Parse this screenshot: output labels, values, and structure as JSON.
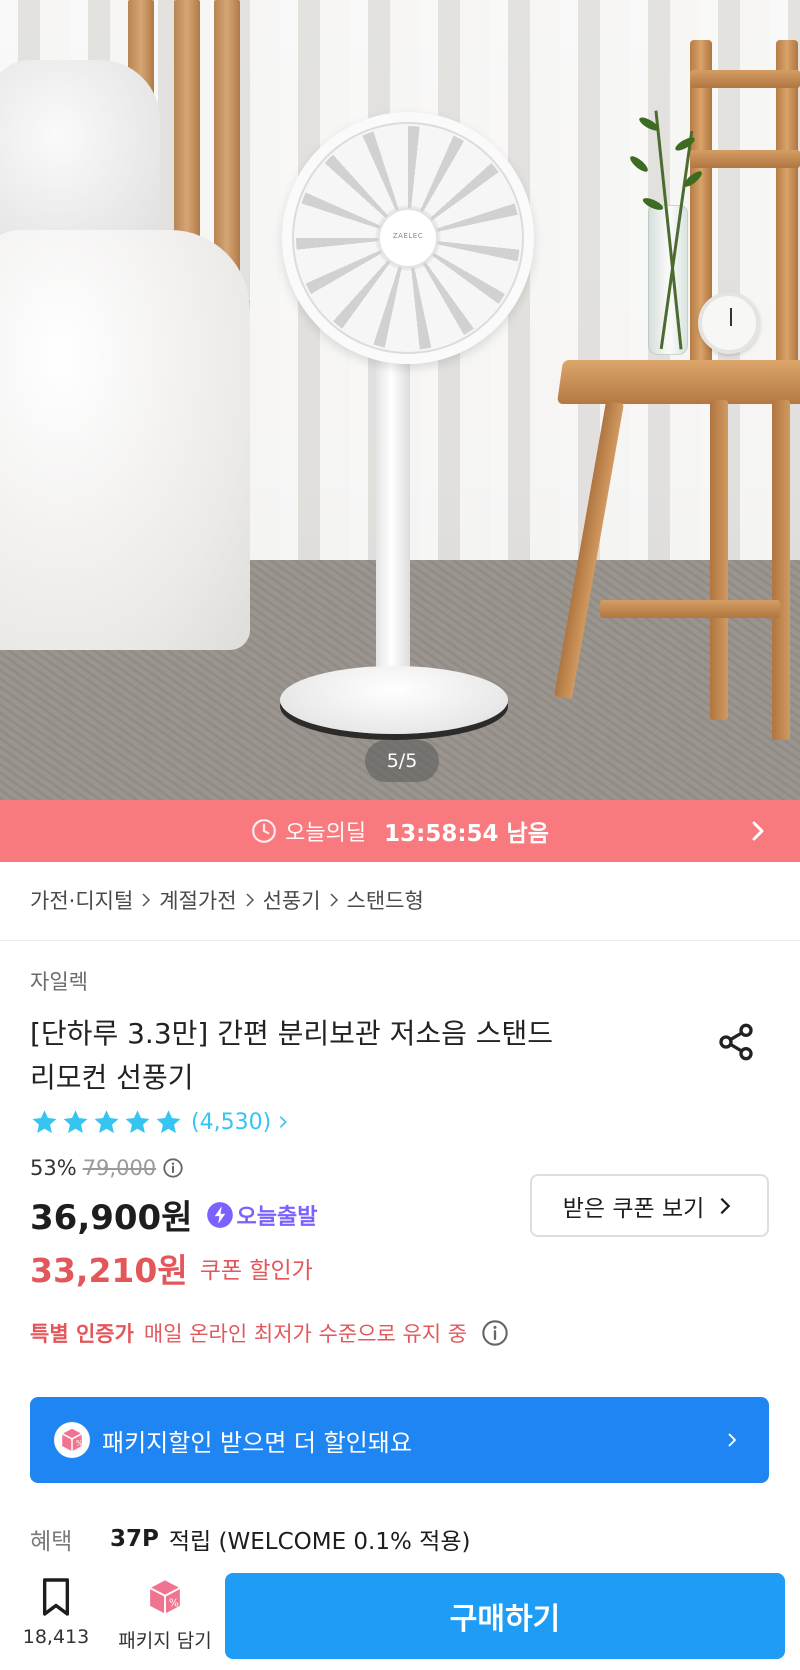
{
  "hero": {
    "fan_brand": "ZAELEC",
    "page_indicator": "5/5"
  },
  "deal": {
    "label": "오늘의딜",
    "time_left": "13:58:54 남음",
    "background_color": "#f87a7e"
  },
  "breadcrumb": {
    "items": [
      "가전·디지털",
      "계절가전",
      "선풍기",
      "스탠드형"
    ]
  },
  "product": {
    "brand": "자일렉",
    "title_line1": "[단하루 3.3만] 간편 분리보관 저소음 스탠드",
    "title_line2": "리모컨 선풍기",
    "rating": {
      "stars": 5,
      "review_count": "(4,530)"
    },
    "discount_rate": "53%",
    "original_price": "79,000",
    "price": "36,900원",
    "today_shipping": "오늘출발",
    "coupon_button": "받은 쿠폰 보기",
    "coupon_price": "33,210원",
    "coupon_label": "쿠폰 할인가",
    "certification": {
      "title": "특별 인증가",
      "description": "매일 온라인 최저가 수준으로 유지 중"
    },
    "package_banner": "패키지할인 받으면 더 할인돼요",
    "benefit": {
      "label": "혜택",
      "points": "37P",
      "description": "적립 (WELCOME 0.1% 적용)"
    }
  },
  "bottom_bar": {
    "bookmark_count": "18,413",
    "package_add_label": "패키지 담기",
    "buy_label": "구매하기"
  },
  "colors": {
    "accent_blue": "#1f9cf6",
    "coupon_red": "#e3575b",
    "star_blue": "#35c5f0",
    "today_purple": "#7b61ff"
  },
  "icons": [
    "clock-icon",
    "chevron-right-icon",
    "share-icon",
    "star-icon",
    "info-icon",
    "lightning-icon",
    "package-box-icon",
    "bookmark-icon"
  ]
}
